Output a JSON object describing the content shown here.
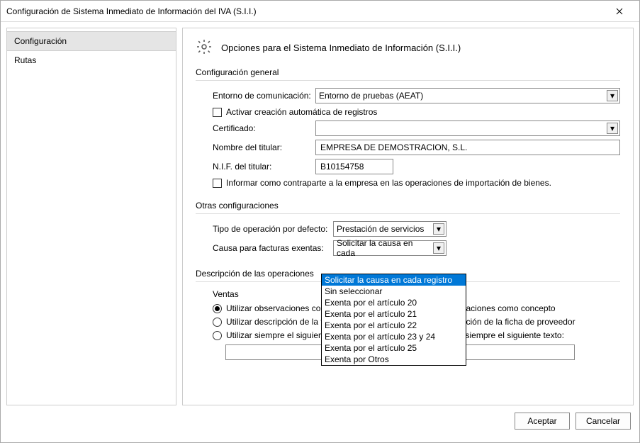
{
  "window": {
    "title": "Configuración de Sistema Inmediato de Información del IVA (S.I.I.)"
  },
  "sidebar": {
    "items": [
      "Configuración",
      "Rutas"
    ],
    "selected": 0
  },
  "header": {
    "title": "Opciones para el Sistema Inmediato de Información (S.I.I.)"
  },
  "section_general": {
    "title": "Configuración general",
    "env_label": "Entorno de comunicación:",
    "env_value": "Entorno de pruebas (AEAT)",
    "auto_create": "Activar creación automática de registros",
    "cert_label": "Certificado:",
    "cert_value": "",
    "holder_name_label": "Nombre del titular:",
    "holder_name_value": "EMPRESA DE DEMOSTRACION, S.L.",
    "nif_label": "N.I.F. del titular:",
    "nif_value": "B10154758",
    "inform_counterpart": "Informar como contraparte a la empresa en las operaciones de importación de bienes."
  },
  "section_other": {
    "title": "Otras configuraciones",
    "op_type_label": "Tipo de operación por defecto:",
    "op_type_value": "Prestación de servicios",
    "cause_label": "Causa para facturas exentas:",
    "cause_value": "Solicitar la causa en cada",
    "cause_options": [
      "Solicitar la causa en cada registro",
      "Sin seleccionar",
      "Exenta por el artículo 20",
      "Exenta por el artículo 21",
      "Exenta por el artículo 22",
      "Exenta por el artículo 23 y 24",
      "Exenta por el artículo 25",
      "Exenta por Otros"
    ],
    "cause_selected": 0
  },
  "section_desc": {
    "title": "Descripción de las operaciones",
    "sales_header": "Ventas",
    "sales_options": [
      "Utilizar observaciones como concepto",
      "Utilizar descripción de la ficha de cliente",
      "Utilizar siempre el siguiente texto:"
    ],
    "purchases_options_tail": [
      "aciones como concepto",
      "ción de la ficha de proveedor",
      "Utilizar siempre el siguiente texto:"
    ]
  },
  "footer": {
    "accept": "Aceptar",
    "cancel": "Cancelar"
  }
}
